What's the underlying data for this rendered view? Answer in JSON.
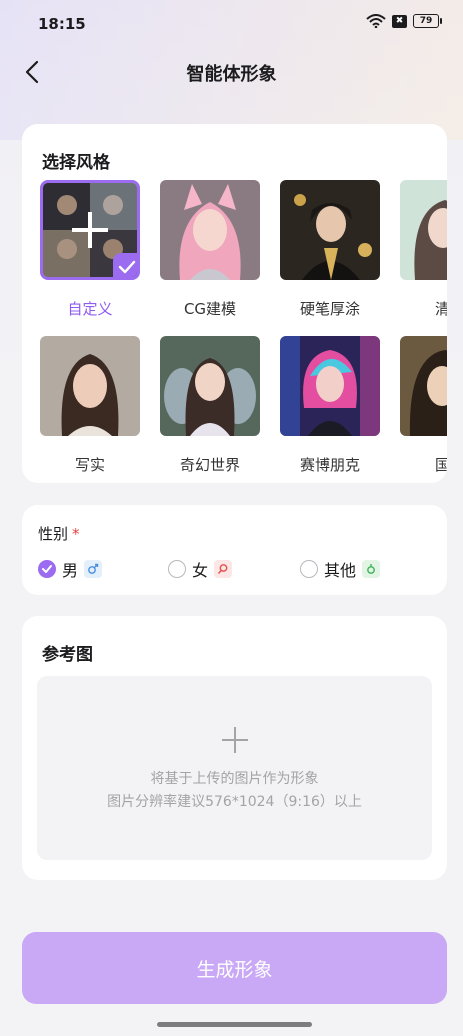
{
  "status_bar": {
    "time": "18:15",
    "battery": "79",
    "wifi_icon": "wifi-icon",
    "sim_icon": "sim-x-icon",
    "sim_glyph": "✖"
  },
  "nav": {
    "title": "智能体形象",
    "back_icon": "back-arrow-icon"
  },
  "style_section": {
    "title": "选择风格",
    "selected": "自定义",
    "items": [
      {
        "label": "自定义",
        "selected": true,
        "icon": "plus-icon"
      },
      {
        "label": "CG建模"
      },
      {
        "label": "硬笔厚涂"
      },
      {
        "label": "清新"
      },
      {
        "label": "写实"
      },
      {
        "label": "奇幻世界"
      },
      {
        "label": "赛博朋克"
      },
      {
        "label": "国风"
      }
    ]
  },
  "gender_section": {
    "title": "性别",
    "required_mark": "*",
    "options": [
      {
        "label": "男",
        "checked": true,
        "icon": "male-icon"
      },
      {
        "label": "女",
        "checked": false,
        "icon": "female-icon"
      },
      {
        "label": "其他",
        "checked": false,
        "icon": "other-gender-icon"
      }
    ]
  },
  "reference_section": {
    "title": "参考图",
    "upload_line1": "将基于上传的图片作为形象",
    "upload_line2": "图片分辨率建议576*1024（9:16）以上"
  },
  "generate_button": {
    "label": "生成形象"
  },
  "colors": {
    "accent": "#9b6bf0",
    "button_bg": "#c9a8f6",
    "required": "#e0443c"
  }
}
